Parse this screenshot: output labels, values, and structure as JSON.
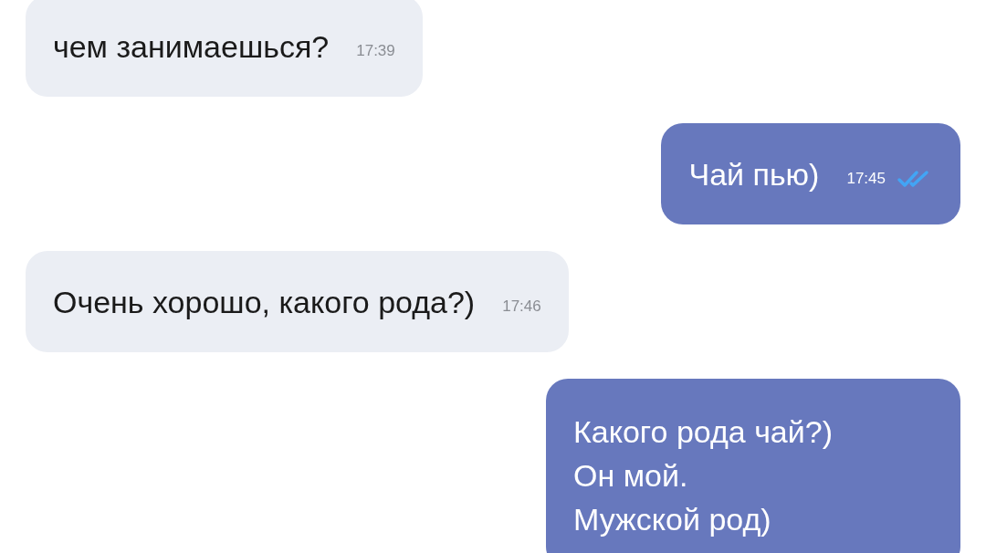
{
  "messages": [
    {
      "kind": "incoming",
      "text": "чем занимаешься?",
      "time": "17:39"
    },
    {
      "kind": "outgoing",
      "text": "Чай пью)",
      "time": "17:45",
      "read": true
    },
    {
      "kind": "incoming",
      "text": "Очень хорошо, какого рода?)",
      "time": "17:46"
    },
    {
      "kind": "outgoing",
      "lines": [
        "Какого рода чай?)",
        "Он мой.",
        "Мужской род)"
      ]
    }
  ]
}
